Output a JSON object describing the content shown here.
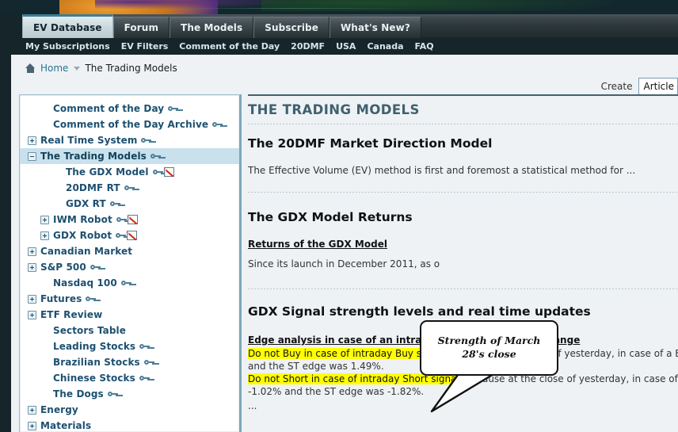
{
  "header": {
    "tabs": [
      {
        "label": "EV Database",
        "active": true
      },
      {
        "label": "Forum",
        "active": false
      },
      {
        "label": "The Models",
        "active": false
      },
      {
        "label": "Subscribe",
        "active": false
      },
      {
        "label": "What's New?",
        "active": false
      }
    ],
    "subnav": [
      "My Subscriptions",
      "EV Filters",
      "Comment of the Day",
      "20DMF",
      "USA",
      "Canada",
      "FAQ"
    ]
  },
  "breadcrumb": {
    "home_icon": "home-icon",
    "home_label": "Home",
    "separator_icon": "chevron-separator-icon",
    "current": "The Trading Models"
  },
  "toolbar": {
    "create_label": "Create",
    "create_value": "Article"
  },
  "sidebar": {
    "items": [
      {
        "label": "Comment of the Day",
        "indent": 1,
        "toggle": "none",
        "key": true,
        "chart": false,
        "selected": false
      },
      {
        "label": "Comment of the Day Archive",
        "indent": 1,
        "toggle": "none",
        "key": true,
        "chart": false,
        "selected": false
      },
      {
        "label": "Real Time System",
        "indent": 0,
        "toggle": "plus",
        "key": true,
        "chart": false,
        "selected": false
      },
      {
        "label": "The Trading Models",
        "indent": 0,
        "toggle": "minus",
        "key": true,
        "chart": false,
        "selected": true
      },
      {
        "label": "The GDX Model",
        "indent": 2,
        "toggle": "none",
        "key": true,
        "chart": true,
        "selected": false
      },
      {
        "label": "20DMF RT",
        "indent": 2,
        "toggle": "none",
        "key": true,
        "chart": false,
        "selected": false
      },
      {
        "label": "GDX RT",
        "indent": 2,
        "toggle": "none",
        "key": true,
        "chart": false,
        "selected": false
      },
      {
        "label": "IWM Robot",
        "indent": 1,
        "toggle": "plus",
        "key": true,
        "chart": true,
        "selected": false
      },
      {
        "label": "GDX Robot",
        "indent": 1,
        "toggle": "plus",
        "key": true,
        "chart": true,
        "selected": false
      },
      {
        "label": "Canadian Market",
        "indent": 0,
        "toggle": "plus",
        "key": false,
        "chart": false,
        "selected": false
      },
      {
        "label": "S&P 500",
        "indent": 0,
        "toggle": "plus",
        "key": true,
        "chart": false,
        "selected": false
      },
      {
        "label": "Nasdaq 100",
        "indent": 1,
        "toggle": "none",
        "key": true,
        "chart": false,
        "selected": false
      },
      {
        "label": "Futures",
        "indent": 0,
        "toggle": "plus",
        "key": true,
        "chart": false,
        "selected": false
      },
      {
        "label": "ETF Review",
        "indent": 0,
        "toggle": "plus",
        "key": false,
        "chart": false,
        "selected": false
      },
      {
        "label": "Sectors Table",
        "indent": 1,
        "toggle": "none",
        "key": false,
        "chart": false,
        "selected": false
      },
      {
        "label": "Leading Stocks",
        "indent": 1,
        "toggle": "none",
        "key": true,
        "chart": false,
        "selected": false
      },
      {
        "label": "Brazilian Stocks",
        "indent": 1,
        "toggle": "none",
        "key": true,
        "chart": false,
        "selected": false
      },
      {
        "label": "Chinese Stocks",
        "indent": 1,
        "toggle": "none",
        "key": true,
        "chart": false,
        "selected": false
      },
      {
        "label": "The Dogs",
        "indent": 1,
        "toggle": "none",
        "key": true,
        "chart": false,
        "selected": false
      },
      {
        "label": "Energy",
        "indent": 0,
        "toggle": "plus",
        "key": false,
        "chart": false,
        "selected": false
      },
      {
        "label": "Materials",
        "indent": 0,
        "toggle": "plus",
        "key": false,
        "chart": false,
        "selected": false
      }
    ]
  },
  "main": {
    "page_title": "THE TRADING MODELS",
    "section1": {
      "heading": "The 20DMF Market Direction Model",
      "text": "The Effective Volume (EV) method is first and foremost a statistical method for ..."
    },
    "section2": {
      "heading": "The GDX Model Returns",
      "link": "Returns of the GDX Model",
      "text": "Since its launch in December 2011, as o"
    },
    "section3": {
      "heading": "GDX Signal strength levels and real time updates",
      "sub_heading": "Edge analysis in case of an intraday real time GDX MF change",
      "line1_hl": "Do not Buy in case of intraday Buy signal,",
      "line1_rest": " because at the close of yesterday, in case of a Buy signal",
      "line2": "and the ST edge was 1.49%.",
      "line3_hl": "Do not Short in case of intraday Short signal,",
      "line3_rest": " because at the close of yesterday, in case of a Short",
      "line4": "-1.02% and the ST edge was -1.82%.",
      "line5": "..."
    }
  },
  "callout": {
    "text": "Strength of March 28's close"
  },
  "colors": {
    "accent_teal": "#3b7f96",
    "dark_nav": "#16252a",
    "title_blue": "#40606f",
    "tree_blue": "#1d5070",
    "selected_row": "#c9e0ed",
    "highlight_yellow": "#ffff00",
    "link_teal": "#2a7590",
    "page_bg": "#eef2f5"
  }
}
